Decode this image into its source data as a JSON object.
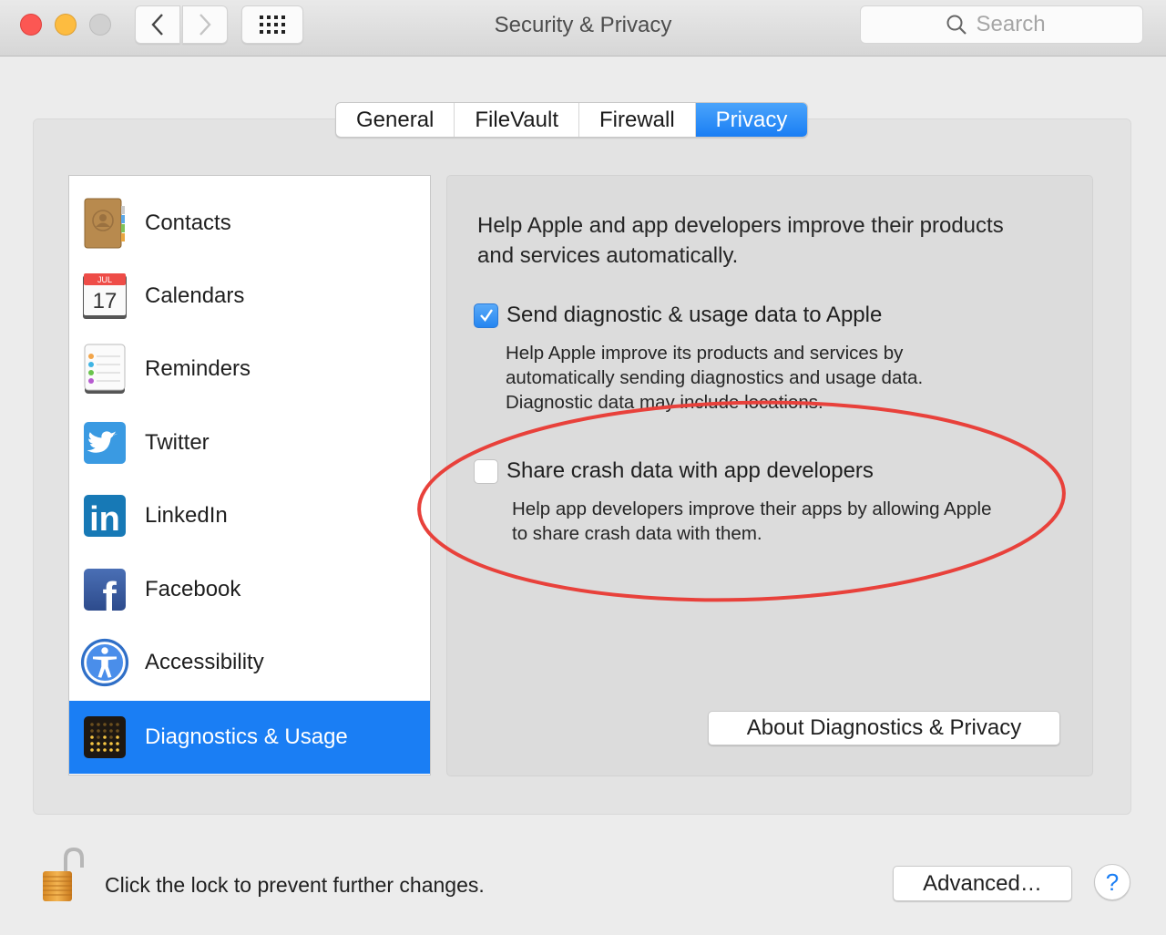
{
  "window": {
    "title": "Security & Privacy",
    "search": {
      "placeholder": "Search",
      "value": ""
    },
    "traffic_lights": [
      "close",
      "minimize",
      "zoom"
    ]
  },
  "toolbar": {
    "back_icon": "chevron-left-icon",
    "forward_icon": "chevron-right-icon",
    "show_all_icon": "grid-icon"
  },
  "tabs": [
    {
      "label": "General",
      "active": false
    },
    {
      "label": "FileVault",
      "active": false
    },
    {
      "label": "Firewall",
      "active": false
    },
    {
      "label": "Privacy",
      "active": true
    }
  ],
  "sidebar": {
    "items": [
      {
        "label": "Contacts",
        "icon": "contacts-icon",
        "selected": false
      },
      {
        "label": "Calendars",
        "icon": "calendar-icon",
        "selected": false,
        "icon_month": "JUL",
        "icon_day": "17"
      },
      {
        "label": "Reminders",
        "icon": "reminders-icon",
        "selected": false
      },
      {
        "label": "Twitter",
        "icon": "twitter-icon",
        "selected": false
      },
      {
        "label": "LinkedIn",
        "icon": "linkedin-icon",
        "selected": false,
        "icon_text": "in"
      },
      {
        "label": "Facebook",
        "icon": "facebook-icon",
        "selected": false,
        "icon_text": "f"
      },
      {
        "label": "Accessibility",
        "icon": "accessibility-icon",
        "selected": false
      },
      {
        "label": "Diagnostics & Usage",
        "icon": "diagnostics-icon",
        "selected": true
      }
    ]
  },
  "panel": {
    "intro": "Help Apple and app developers improve their products and services automatically.",
    "options": [
      {
        "label": "Send diagnostic & usage data to Apple",
        "checked": true,
        "description_lines": [
          "Help Apple improve its products and services by",
          "automatically sending diagnostics and usage data.",
          "Diagnostic data may include locations."
        ]
      },
      {
        "label": "Share crash data with app developers",
        "checked": false,
        "description_lines": [
          "Help app developers improve their apps by allowing Apple",
          "to share crash data with them."
        ]
      }
    ],
    "about_button": "About Diagnostics & Privacy"
  },
  "footer": {
    "lock_text": "Click the lock to prevent further changes.",
    "lock_state": "unlocked",
    "advanced_button": "Advanced…",
    "help_button": "?"
  },
  "annotation": {
    "type": "red-ellipse",
    "highlights": "Share crash data with app developers",
    "color": "#e8413b"
  },
  "colors": {
    "accent": "#1a7ef4",
    "checkbox_on": "#2585f0",
    "annotation": "#e8413b"
  }
}
